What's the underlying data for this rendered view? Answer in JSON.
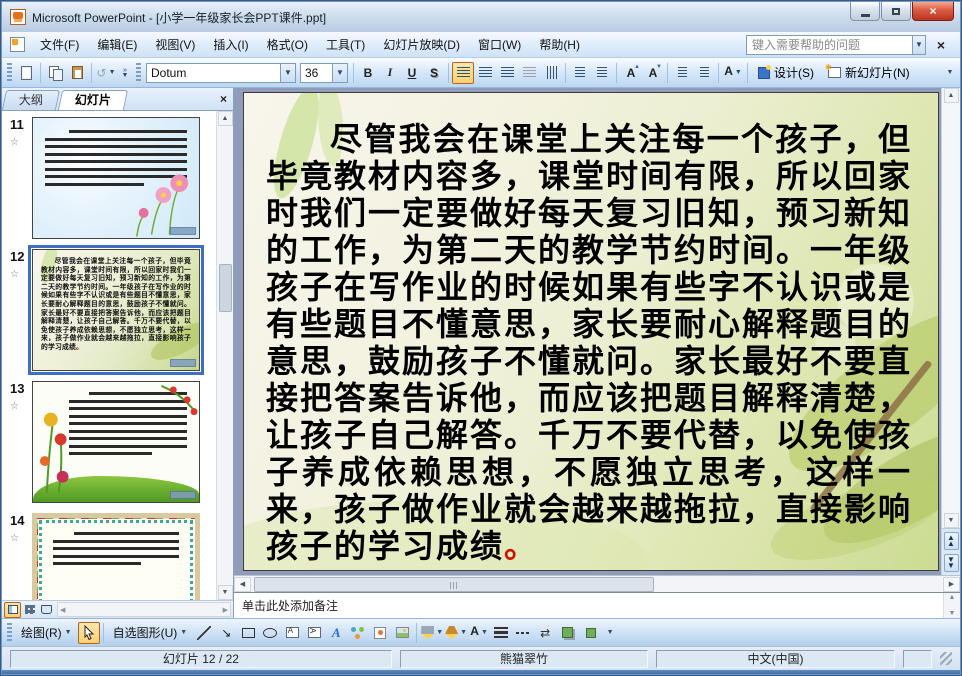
{
  "window": {
    "title": "Microsoft PowerPoint - [小学一年级家长会PPT课件.ppt]"
  },
  "menubar": {
    "items": [
      {
        "label": "文件(F)"
      },
      {
        "label": "编辑(E)"
      },
      {
        "label": "视图(V)"
      },
      {
        "label": "插入(I)"
      },
      {
        "label": "格式(O)"
      },
      {
        "label": "工具(T)"
      },
      {
        "label": "幻灯片放映(D)"
      },
      {
        "label": "窗口(W)"
      },
      {
        "label": "帮助(H)"
      }
    ],
    "help_box": {
      "placeholder": "键入需要帮助的问题"
    }
  },
  "toolbar": {
    "font_name": "Dotum",
    "font_size": "36",
    "bold": "B",
    "italic": "I",
    "underline": "U",
    "shadow": "S",
    "font_color": "A",
    "grow_font": "A",
    "shrink_font": "A",
    "design_label": "设计(S)",
    "new_slide_label": "新幻灯片(N)"
  },
  "left_panel": {
    "tab_outline": "大纲",
    "tab_slides": "幻灯片",
    "slides": [
      {
        "number": "11"
      },
      {
        "number": "12"
      },
      {
        "number": "13"
      },
      {
        "number": "14"
      }
    ]
  },
  "slide": {
    "body": "尽管我会在课堂上关注每一个孩子，但毕竟教材内容多，课堂时间有限，所以回家时我们一定要做好每天复习旧知，预习新知的工作，为第二天的教学节约时间。一年级孩子在写作业的时候如果有些字不认识或是有些题目不懂意思，家长要耐心解释题目的意思，鼓励孩子不懂就问。家长最好不要直接把答案告诉他，而应该把题目解释清楚，让孩子自己解答。千万不要代替，以免使孩子养成依赖思想，不愿独立思考，这样一来，孩子做作业就会越来越拖拉，直接影响孩子的学习成绩",
    "final_period": "。"
  },
  "notes": {
    "placeholder": "单击此处添加备注"
  },
  "drawbar": {
    "draw_label": "绘图(R)",
    "autoshapes_label": "自选图形(U)",
    "font_color": "A"
  },
  "statusbar": {
    "slide_indicator": "幻灯片 12 / 22",
    "design_template": "熊猫翠竹",
    "language": "中文(中国)"
  },
  "colors": {
    "highlight_orange": "#ffd070",
    "selection_blue": "#3f6fc2",
    "close_red": "#b83520",
    "slide_period_red": "#cc1100"
  }
}
